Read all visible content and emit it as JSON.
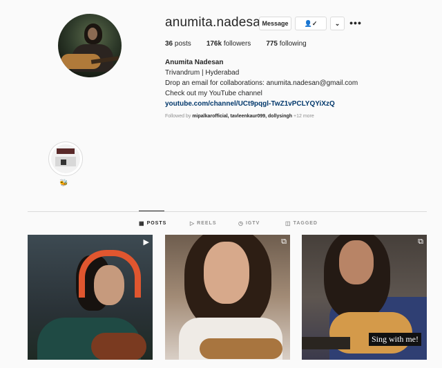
{
  "profile": {
    "username": "anumita.nadesan",
    "message_label": "Message",
    "follow_icon_text": "👤✓",
    "chevron": "⌄",
    "more": "•••",
    "stats": {
      "posts_count": "36",
      "posts_label": "posts",
      "followers_count": "176k",
      "followers_label": "followers",
      "following_count": "775",
      "following_label": "following"
    },
    "bio": {
      "name": "Anumita Nadesan",
      "line1": "Trivandrum | Hyderabad",
      "line2": "Drop an email for collaborations: anumita.nadesan@gmail.com",
      "line3": "Check out my YouTube channel",
      "link": "youtube.com/channel/UCt9pqgl-TwZ1vPCLYQYiXzQ"
    },
    "followed_by": {
      "prefix": "Followed by",
      "names": "mipalkarofficial, tavleenkaur099, dollysingh",
      "more": "+12 more"
    }
  },
  "highlights": [
    {
      "label": "🐝"
    }
  ],
  "tabs": [
    {
      "icon": "▦",
      "label": "POSTS"
    },
    {
      "icon": "▷",
      "label": "REELS"
    },
    {
      "icon": "◷",
      "label": "IGTV"
    },
    {
      "icon": "◫",
      "label": "TAGGED"
    }
  ],
  "posts": [
    {
      "type_icon": "▶"
    },
    {
      "type_icon": "⧉"
    },
    {
      "type_icon": "⧉",
      "overlay_text": "Sing with me!"
    }
  ]
}
